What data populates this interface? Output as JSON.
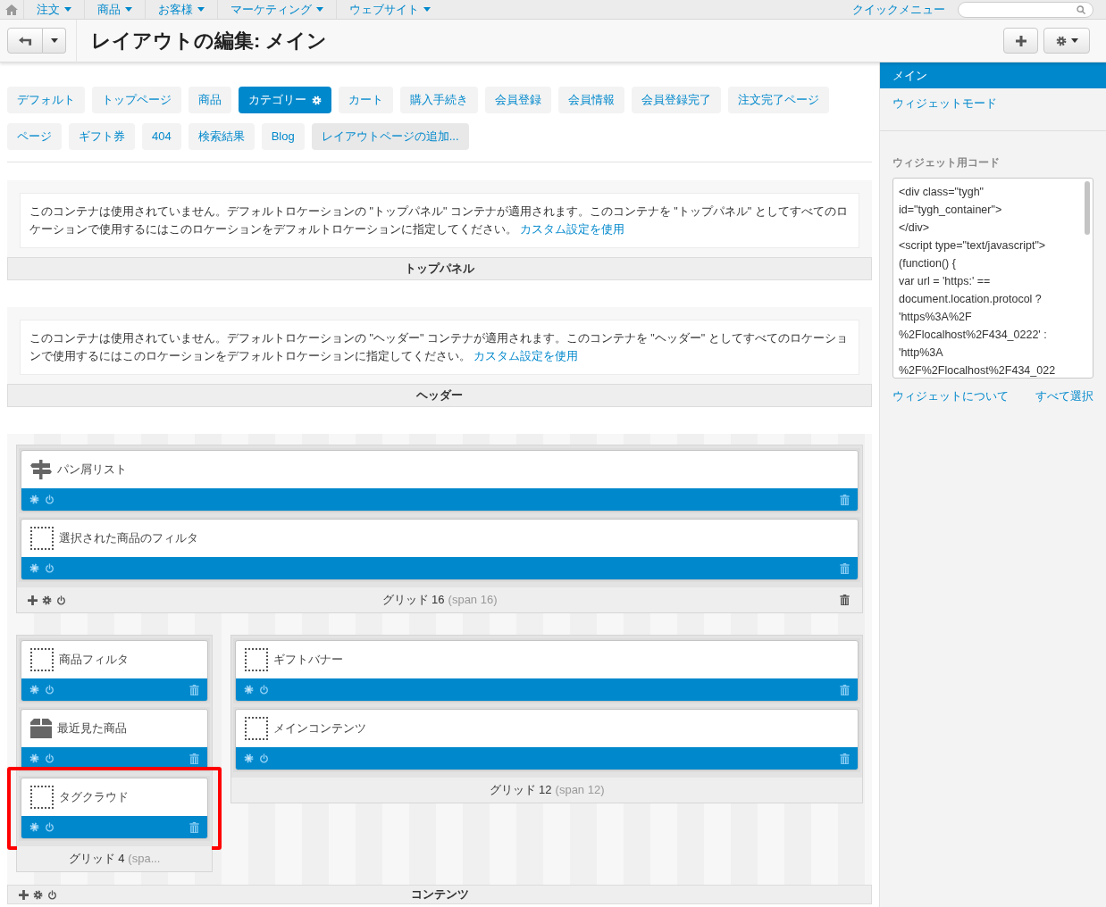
{
  "top_nav": {
    "menus": [
      {
        "label": "注文"
      },
      {
        "label": "商品"
      },
      {
        "label": "お客様"
      },
      {
        "label": "マーケティング"
      },
      {
        "label": "ウェブサイト"
      }
    ],
    "quick_menu": "クイックメニュー"
  },
  "header": {
    "title": "レイアウトの編集: メイン"
  },
  "layout_tabs": [
    {
      "label": "デフォルト",
      "kind": "page",
      "selected": false
    },
    {
      "label": "トップページ",
      "kind": "page",
      "selected": false
    },
    {
      "label": "商品",
      "kind": "page",
      "selected": false
    },
    {
      "label": "カテゴリー",
      "kind": "page",
      "selected": true
    },
    {
      "label": "カート",
      "kind": "page",
      "selected": false
    },
    {
      "label": "購入手続き",
      "kind": "page",
      "selected": false
    },
    {
      "label": "会員登録",
      "kind": "page",
      "selected": false
    },
    {
      "label": "会員情報",
      "kind": "page",
      "selected": false
    },
    {
      "label": "会員登録完了",
      "kind": "page",
      "selected": false
    },
    {
      "label": "注文完了ページ",
      "kind": "page",
      "selected": false
    },
    {
      "label": "ページ",
      "kind": "page",
      "selected": false
    },
    {
      "label": "ギフト券",
      "kind": "page",
      "selected": false
    },
    {
      "label": "404",
      "kind": "page",
      "selected": false
    },
    {
      "label": "検索結果",
      "kind": "page",
      "selected": false
    },
    {
      "label": "Blog",
      "kind": "page",
      "selected": false
    },
    {
      "label": "レイアウトページの追加...",
      "kind": "add",
      "selected": false
    }
  ],
  "containers": [
    {
      "kind": "notice",
      "notice": "このコンテナは使用されていません。デフォルトロケーションの \"トップパネル\" コンテナが適用されます。このコンテナを \"トップパネル\" としてすべてのロケーションで使用するにはこのロケーションをデフォルトロケーションに指定してください。",
      "link": "カスタム設定を使用",
      "title": "トップパネル"
    },
    {
      "kind": "notice",
      "notice": "このコンテナは使用されていません。デフォルトロケーションの \"ヘッダー\" コンテナが適用されます。このコンテナを \"ヘッダー\" としてすべてのロケーションで使用するにはこのロケーションをデフォルトロケーションに指定してください。",
      "link": "カスタム設定を使用",
      "title": "ヘッダー"
    },
    {
      "kind": "grids",
      "title": "コンテンツ",
      "rows": [
        {
          "grids": [
            {
              "label": "グリッド 16",
              "span": "(span 16)",
              "tools": true,
              "widgets": [
                {
                  "name": "パン屑リスト",
                  "kind": "signpost",
                  "highlighted": false
                },
                {
                  "name": "選択された商品のフィルタ",
                  "kind": "placeholder",
                  "highlighted": false
                }
              ]
            }
          ]
        },
        {
          "grids": [
            {
              "label": "グリッド 4",
              "span": "(spa...",
              "tools": false,
              "widgets": [
                {
                  "name": "商品フィルタ",
                  "kind": "placeholder",
                  "highlighted": false
                },
                {
                  "name": "最近見た商品",
                  "kind": "box",
                  "highlighted": false
                },
                {
                  "name": "タグクラウド",
                  "kind": "placeholder",
                  "highlighted": true
                }
              ]
            },
            {
              "label": "グリッド 12",
              "span": "(span 12)",
              "tools": false,
              "widgets": [
                {
                  "name": "ギフトバナー",
                  "kind": "placeholder",
                  "highlighted": false
                },
                {
                  "name": "メインコンテンツ",
                  "kind": "placeholder",
                  "highlighted": false
                }
              ]
            }
          ]
        }
      ]
    }
  ],
  "sidebar": {
    "items": [
      {
        "label": "メイン",
        "selected": true
      },
      {
        "label": "ウィジェットモード",
        "selected": false
      }
    ],
    "code_label": "ウィジェット用コード",
    "code_lines": [
      "<div class=\"tygh\"",
      "id=\"tygh_container\">",
      "</div>",
      "<script type=\"text/javascript\">",
      "(function() {",
      "var url = 'https:' ==",
      "document.location.protocol ?",
      "'https%3A%2F",
      "%2Flocalhost%2F434_0222' :",
      "'http%3A",
      "%2F%2Flocalhost%2F434_022"
    ],
    "links": [
      {
        "label": "ウィジェットについて"
      },
      {
        "label": "すべて選択"
      }
    ]
  }
}
